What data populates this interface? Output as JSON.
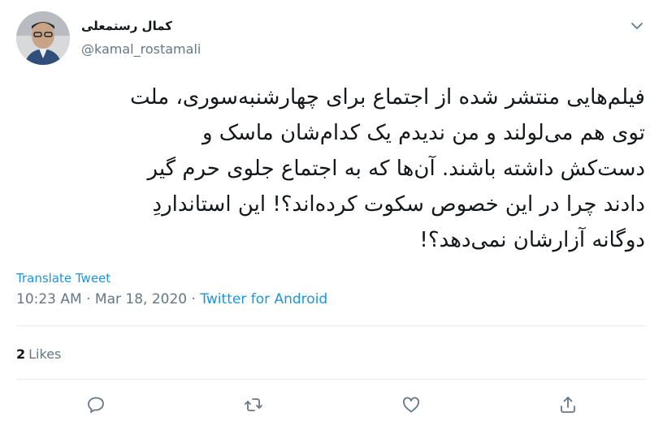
{
  "user": {
    "display_name": "کمال رستمعلی",
    "handle": "@kamal_rostamali"
  },
  "tweet": {
    "lines": [
      "فیلم‌هایی منتشر شده از اجتماع برای چهارشنبه‌سوری، ملت",
      "توی هم می‌لولند و من ندیدم یک کدام‌شان ماسک و",
      "دست‌کش داشته باشند. آن‌ها که به اجتماع جلوی حرم گیر",
      "دادند چرا در این خصوص سکوت کرده‌اند؟! این استانداردِ",
      "دوگانه آزارشان نمی‌دهد؟!"
    ]
  },
  "translate_label": "Translate Tweet",
  "meta": {
    "time": "10:23 AM",
    "separator": "·",
    "date": "Mar 18, 2020",
    "source": "Twitter for Android"
  },
  "likes": {
    "count": "2",
    "label": "Likes"
  },
  "icons": {
    "caret": "chevron-down-icon",
    "reply": "reply-icon",
    "retweet": "retweet-icon",
    "like": "heart-icon",
    "share": "share-icon"
  },
  "colors": {
    "link": "#1b95e0",
    "muted": "#657786",
    "text": "#14171a",
    "divider": "#e6ecf0"
  }
}
